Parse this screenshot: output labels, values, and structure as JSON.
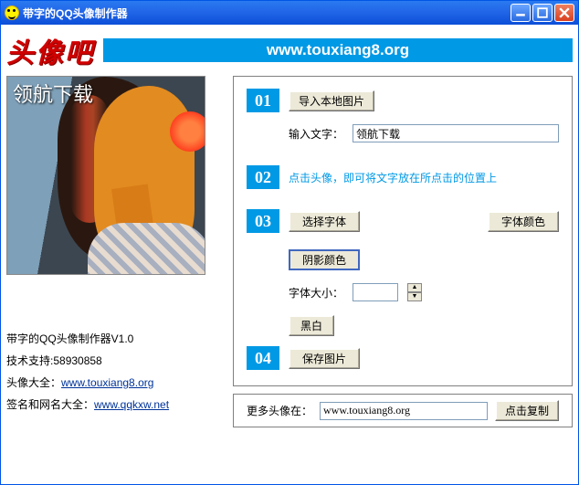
{
  "window": {
    "title": "带字的QQ头像制作器"
  },
  "banner": {
    "logo": "头像吧",
    "url": "www.touxiang8.org"
  },
  "preview": {
    "overlay_text": "领航下载"
  },
  "info": {
    "line1_prefix": "带字的QQ头像制作器",
    "version": "V1.0",
    "line2_label": "技术支持:",
    "line2_value": "58930858",
    "line3_label": "头像大全：",
    "line3_link": "www.touxiang8.org",
    "line4_label": "签名和网名大全：",
    "line4_link": "www.qqkxw.net"
  },
  "steps": {
    "s01": "01",
    "s02": "02",
    "s03": "03",
    "s04": "04",
    "import_btn": "导入本地图片",
    "input_label": "输入文字：",
    "input_value": "领航下载",
    "tip": "点击头像，即可将文字放在所点击的位置上",
    "font_btn": "选择字体",
    "font_color_btn": "字体颜色",
    "shadow_btn": "阴影颜色",
    "size_label": "字体大小：",
    "bw_btn": "黑白",
    "save_btn": "保存图片"
  },
  "footer": {
    "label": "更多头像在：",
    "url": "www.touxiang8.org",
    "copy_btn": "点击复制"
  }
}
